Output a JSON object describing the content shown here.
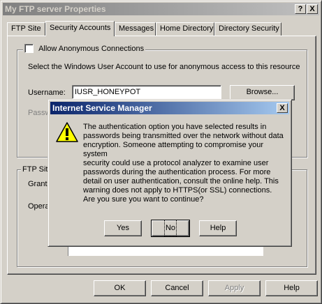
{
  "window": {
    "title": "My FTP server Properties",
    "help_button": "?",
    "close_button": "X"
  },
  "tabs": [
    {
      "label": "FTP Site"
    },
    {
      "label": "Security Accounts"
    },
    {
      "label": "Messages"
    },
    {
      "label": "Home Directory"
    },
    {
      "label": "Directory Security"
    }
  ],
  "anonymous": {
    "checkbox_label": "Allow Anonymous Connections",
    "checked": false,
    "description": "Select the Windows User Account to use for anonymous access to this resource",
    "username_label": "Username:",
    "username_value": "IUSR_HONEYPOT",
    "browse_button": "Browse...",
    "password_label": "Passw"
  },
  "operators": {
    "group_label": "FTP Site",
    "grant_label": "Grant",
    "operators_label": "Opera"
  },
  "footer": {
    "ok": "OK",
    "cancel": "Cancel",
    "apply": "Apply",
    "help": "Help"
  },
  "dialog": {
    "title": "Internet Service Manager",
    "close_button": "X",
    "icon": "warning-icon",
    "message": "The authentication option you have selected results in\npasswords being transmitted over the network without data\nencryption. Someone attempting to compromise your system\nsecurity could use a protocol analyzer to examine user\npasswords during the authentication process. For more\ndetail on user authentication, consult the online help.  This\nwarning does not apply to HTTPS(or SSL) connections.",
    "question": "Are you sure you want to continue?",
    "yes": "Yes",
    "no": "No",
    "help": "Help"
  }
}
